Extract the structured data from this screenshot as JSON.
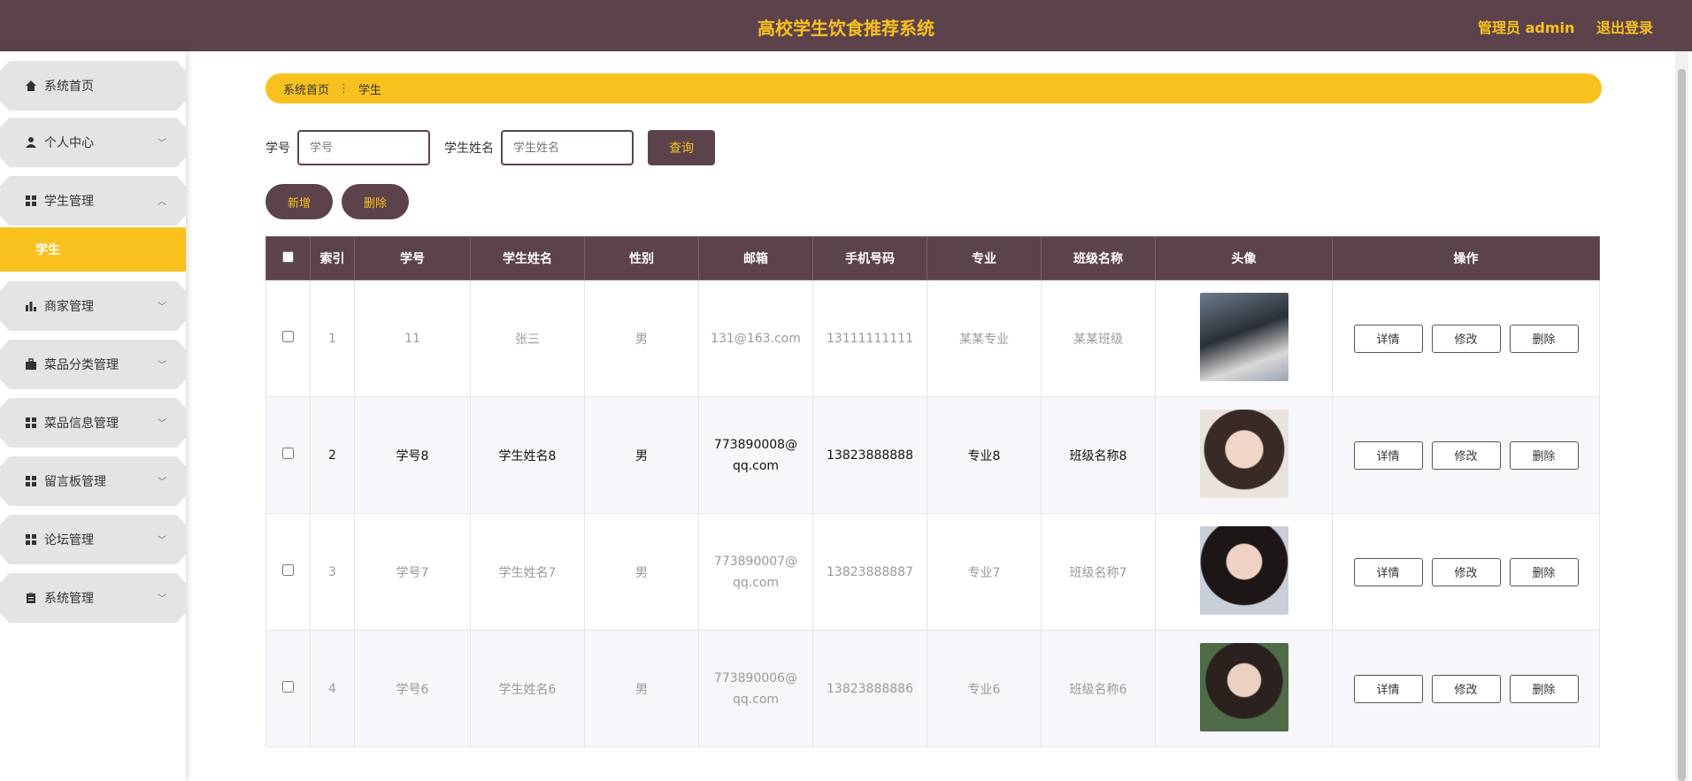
{
  "header": {
    "title": "高校学生饮食推荐系统",
    "admin": "管理员 admin",
    "logout": "退出登录"
  },
  "sidebar": {
    "items": [
      {
        "label": "系统首页",
        "icon": "home-icon"
      },
      {
        "label": "个人中心",
        "icon": "user-icon"
      },
      {
        "label": "学生管理",
        "icon": "grid-icon"
      },
      {
        "label": "商家管理",
        "icon": "bar-chart-icon"
      },
      {
        "label": "菜品分类管理",
        "icon": "briefcase-icon"
      },
      {
        "label": "菜品信息管理",
        "icon": "grid-icon"
      },
      {
        "label": "留言板管理",
        "icon": "grid-icon"
      },
      {
        "label": "论坛管理",
        "icon": "grid-icon"
      },
      {
        "label": "系统管理",
        "icon": "clipboard-icon"
      }
    ],
    "sub_item": "学生"
  },
  "breadcrumb": {
    "home": "系统首页",
    "current": "学生"
  },
  "search": {
    "field1_label": "学号",
    "field1_placeholder": "学号",
    "field2_label": "学生姓名",
    "field2_placeholder": "学生姓名",
    "query_label": "查询"
  },
  "actions": {
    "add_label": "新增",
    "delete_label": "删除"
  },
  "table": {
    "headers": [
      "索引",
      "学号",
      "学生姓名",
      "性别",
      "邮箱",
      "手机号码",
      "专业",
      "班级名称",
      "头像",
      "操作"
    ],
    "rows": [
      {
        "idx": "1",
        "sid": "11",
        "name": "张三",
        "gender": "男",
        "email": "131@163.com",
        "phone": "13111111111",
        "major": "某某专业",
        "cls": "某某班级"
      },
      {
        "idx": "2",
        "sid": "学号8",
        "name": "学生姓名8",
        "gender": "男",
        "email": "773890008@qq.com",
        "phone": "13823888888",
        "major": "专业8",
        "cls": "班级名称8"
      },
      {
        "idx": "3",
        "sid": "学号7",
        "name": "学生姓名7",
        "gender": "男",
        "email": "773890007@qq.com",
        "phone": "13823888887",
        "major": "专业7",
        "cls": "班级名称7"
      },
      {
        "idx": "4",
        "sid": "学号6",
        "name": "学生姓名6",
        "gender": "男",
        "email": "773890006@qq.com",
        "phone": "13823888886",
        "major": "专业6",
        "cls": "班级名称6"
      }
    ],
    "op_detail": "详情",
    "op_edit": "修改",
    "op_delete": "删除"
  },
  "colors": {
    "header_bg": "#5c434b",
    "accent": "#f8c11d"
  }
}
